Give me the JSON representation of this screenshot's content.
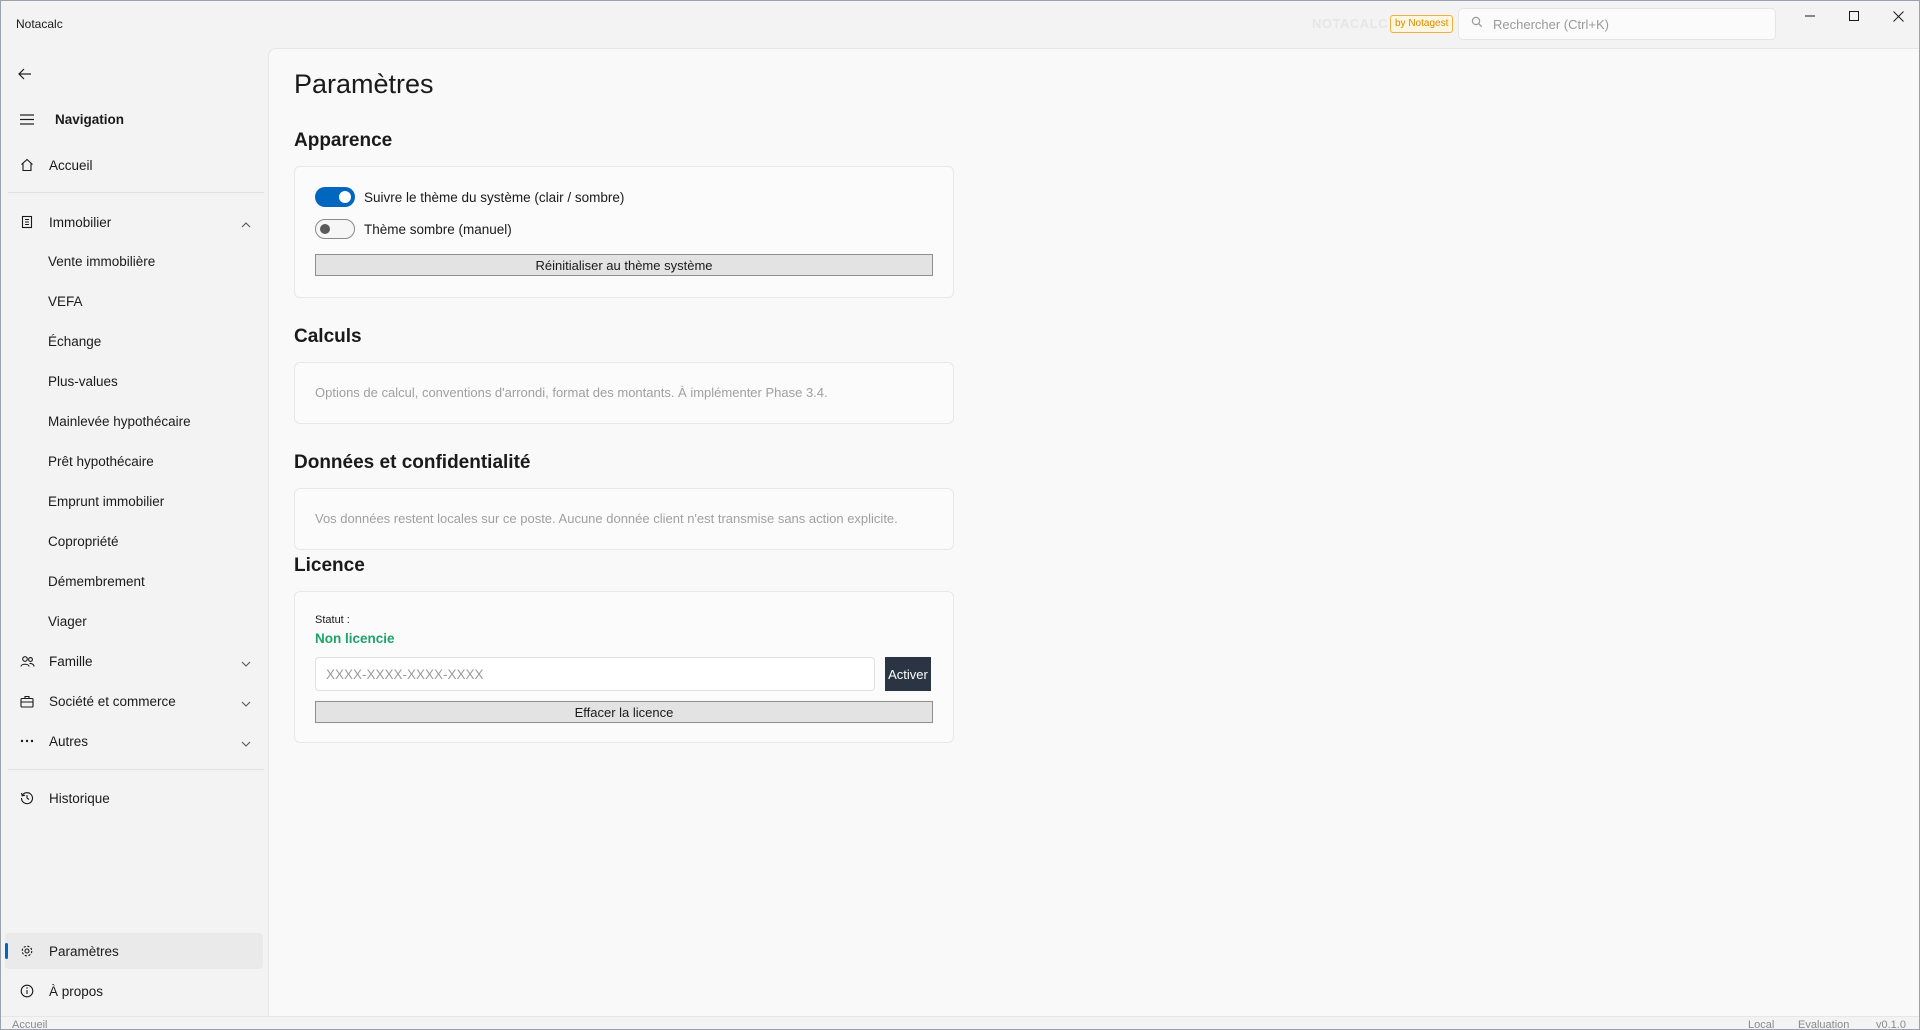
{
  "window": {
    "title": "Notacalc",
    "brand": "NOTACALC",
    "brand_badge": "by Notagest",
    "search_placeholder": "Rechercher (Ctrl+K)"
  },
  "sidebar": {
    "nav_header": "Navigation",
    "items": {
      "accueil": "Accueil",
      "immobilier": "Immobilier",
      "immobilier_sub": [
        "Vente immobilière",
        "VEFA",
        "Échange",
        "Plus-values",
        "Mainlevée hypothécaire",
        "Prêt hypothécaire",
        "Emprunt immobilier",
        "Copropriété",
        "Démembrement",
        "Viager"
      ],
      "famille": "Famille",
      "societe": "Société et commerce",
      "autres": "Autres",
      "historique": "Historique",
      "parametres": "Paramètres",
      "apropos": "À propos"
    }
  },
  "main": {
    "title": "Paramètres",
    "apparence": {
      "title": "Apparence",
      "toggle_system": "Suivre le thème du système (clair / sombre)",
      "toggle_system_on": true,
      "toggle_dark": "Thème sombre (manuel)",
      "toggle_dark_on": false,
      "reset_button": "Réinitialiser au thème système"
    },
    "calculs": {
      "title": "Calculs",
      "text": "Options de calcul, conventions d'arrondi, format des montants. À implémenter Phase 3.4."
    },
    "donnees": {
      "title": "Données et confidentialité",
      "text": "Vos données restent locales sur ce poste. Aucune donnée client n'est transmise sans action explicite."
    },
    "licence": {
      "title": "Licence",
      "statut_label": "Statut :",
      "statut_value": "Non licencie",
      "key_placeholder": "XXXX-XXXX-XXXX-XXXX",
      "activate_button": "Activer",
      "clear_button": "Effacer la licence"
    }
  },
  "statusbar": {
    "left": "Accueil",
    "mode": "Local",
    "license": "Evaluation",
    "version": "v0.1.0"
  },
  "colors": {
    "accent": "#0067c0",
    "success": "#1ea36b",
    "dark_button": "#2b3442"
  }
}
